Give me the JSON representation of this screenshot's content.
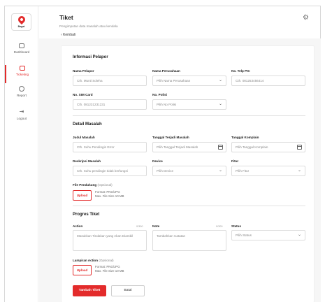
{
  "app": {
    "logo_text": "Bagat"
  },
  "sidebar": {
    "items": [
      {
        "label": "Dashboard",
        "icon": "dashboard-icon"
      },
      {
        "label": "Ticketing",
        "icon": "ticket-icon",
        "active": true
      },
      {
        "label": "Report",
        "icon": "report-icon"
      },
      {
        "label": "Logout",
        "icon": "logout-icon"
      }
    ]
  },
  "header": {
    "title": "Tiket",
    "subtitle": "Pengimputan data masalah atau kendala",
    "back_label": "Kembali",
    "settings_icon": "gear-icon"
  },
  "pelapor": {
    "section_title": "Informasi Pelapor",
    "nama_label": "Nama Pelapor",
    "nama_placeholder": "Cth. Munti Soleha",
    "perusahaan_label": "Nama Perusahaan",
    "perusahaan_placeholder": "Pilih Nama Perusahaan",
    "telp_label": "No. Telp PIC",
    "telp_placeholder": "Cth. 081253456414",
    "sim_label": "No. SIM Card",
    "sim_placeholder": "Cth. 081231231231",
    "polisi_label": "No. Polisi",
    "polisi_placeholder": "Pilih No Polisi"
  },
  "masalah": {
    "section_title": "Detail Masalah",
    "judul_label": "Judul Masalah",
    "judul_placeholder": "Cth. Suhu Pendingin Error",
    "tgl_terjadi_label": "Tanggal Terjadi Masalah",
    "tgl_terjadi_placeholder": "Pilih Tanggal Terjadi Masalah",
    "tgl_komplain_label": "Tanggal Komplain",
    "tgl_komplain_placeholder": "Pilih Tanggal Komplain",
    "deskripsi_label": "Deskripsi Masalah",
    "deskripsi_placeholder": "Cth. Suhu pendingin tidak berfungsi",
    "device_label": "Device",
    "device_placeholder": "Pilih Device",
    "fitur_label": "Fitur",
    "fitur_placeholder": "Pilih Fitur",
    "file_label": "File Pendukung",
    "file_optional": "(Opsional)",
    "upload_label": "Upload",
    "file_hint_1": "Format: PNG/JPG",
    "file_hint_2": "Max. File Size 10 MB"
  },
  "progres": {
    "section_title": "Progres Tiket",
    "action_label": "Action",
    "action_counter": "0/300",
    "action_placeholder": "Masukkan Tindakan yang Akan Diambil",
    "note_label": "Note",
    "note_counter": "0/300",
    "note_placeholder": "Tambahkan Catatan",
    "status_label": "Status",
    "status_placeholder": "Pilih Status",
    "lampiran_label": "Lampiran Action",
    "lampiran_optional": "(Opsional)",
    "upload_label": "Upload",
    "file_hint_1": "Format: PNG/JPG",
    "file_hint_2": "Max. File Size 10 MB"
  },
  "actions": {
    "submit_label": "Tambah Tiket",
    "cancel_label": "Batal"
  },
  "colors": {
    "accent": "#e32b2b"
  }
}
